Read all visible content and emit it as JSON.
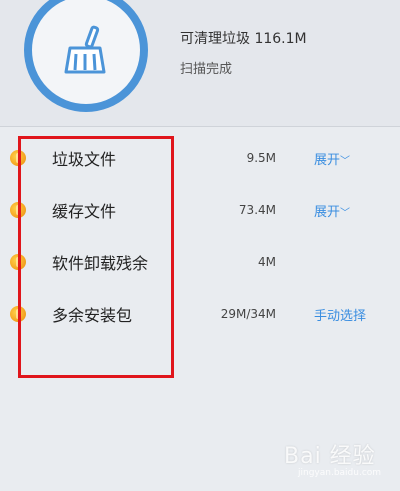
{
  "summary": {
    "garbage_text": "可清理垃圾 116.1M",
    "status_text": "扫描完成"
  },
  "items": [
    {
      "label": "垃圾文件",
      "size": "9.5M",
      "action": "展开"
    },
    {
      "label": "缓存文件",
      "size": "73.4M",
      "action": "展开"
    },
    {
      "label": "软件卸载残余",
      "size": "4M",
      "action": ""
    },
    {
      "label": "多余安装包",
      "size": "29M/34M",
      "action": "手动选择"
    }
  ],
  "icons": {
    "main": "broom-icon",
    "status_dot": "warning-dot-icon",
    "expand": "chevron-down-icon"
  },
  "colors": {
    "accent": "#4b94d8",
    "link": "#3b8ee0",
    "dot": "#f5a623",
    "highlight": "#e0151b"
  },
  "watermark": {
    "main": "Bai 经验",
    "sub": "jingyan.baidu.com"
  }
}
